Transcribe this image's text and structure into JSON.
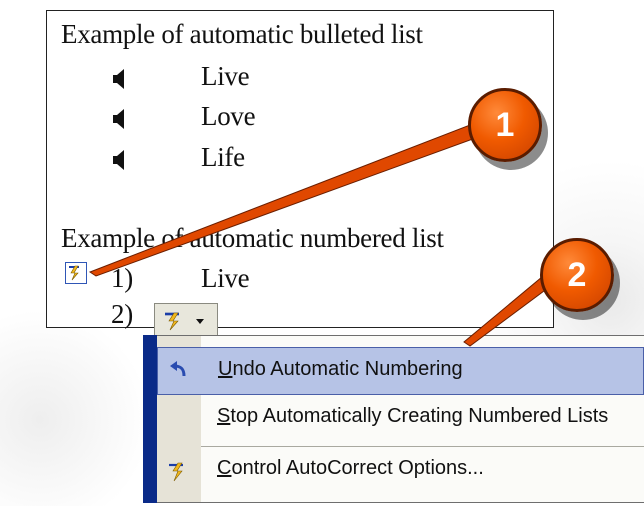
{
  "document": {
    "bulleted_heading": "Example of automatic bulleted list",
    "bulleted_items": [
      "Live",
      "Love",
      "Life"
    ],
    "numbered_heading": "Example of automatic numbered list",
    "numbered_items": [
      {
        "number": "1)",
        "text": "Live"
      },
      {
        "number": "2)",
        "text": ""
      }
    ],
    "bullet_icon": "speaker-bullet-icon"
  },
  "autocorrect_button": {
    "icon": "lightning-autocorrect-icon",
    "dropdown_icon": "triangle-down-icon"
  },
  "menu": {
    "items": [
      {
        "label": "Undo Automatic Numbering",
        "accel": "U",
        "icon": "undo-arrow-icon",
        "highlighted": true
      },
      {
        "label": "Stop Automatically Creating Numbered Lists",
        "accel": "S",
        "icon": "",
        "highlighted": false
      },
      {
        "label": "Control AutoCorrect Options...",
        "accel": "C",
        "icon": "lightning-autocorrect-icon",
        "highlighted": false
      }
    ]
  },
  "callouts": [
    {
      "label": "1"
    },
    {
      "label": "2"
    }
  ],
  "colors": {
    "callout": "#f05a00",
    "menu_highlight": "#b6c3e6",
    "menu_rail": "#0a2a88"
  }
}
